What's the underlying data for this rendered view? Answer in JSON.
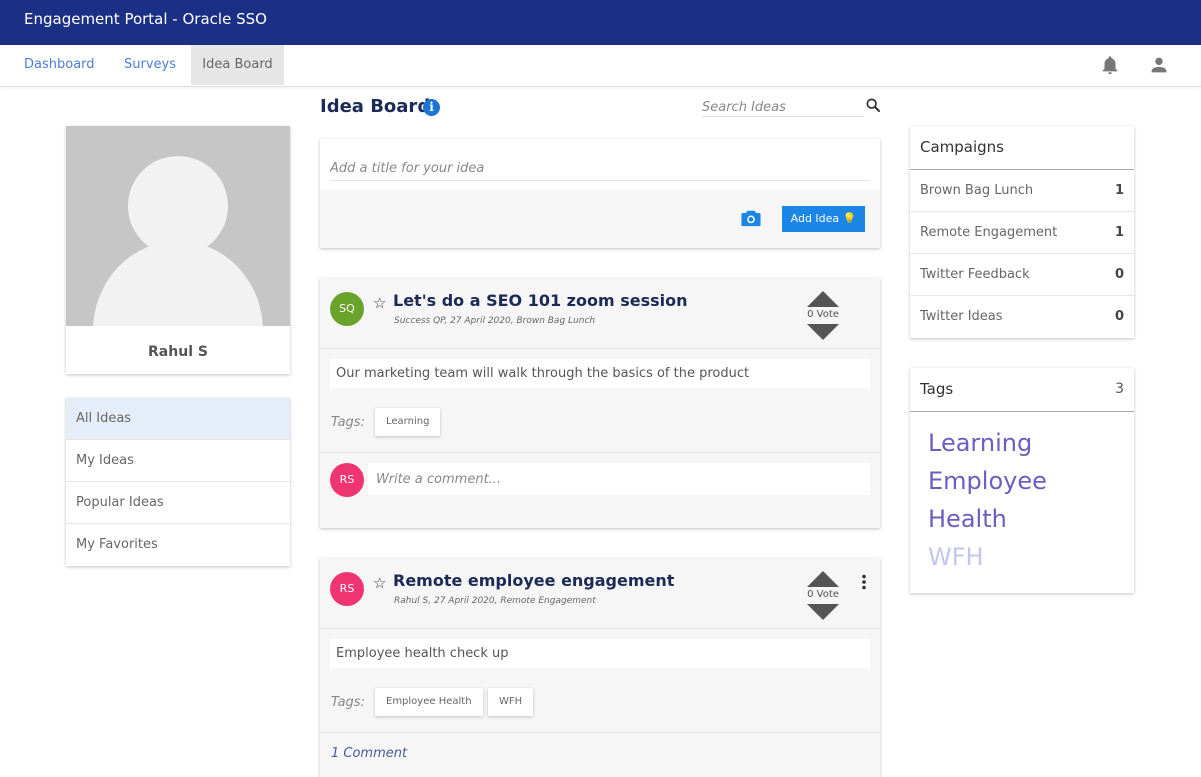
{
  "app": {
    "title": "Engagement Portal - Oracle SSO"
  },
  "nav": {
    "tabs": [
      {
        "label": "Dashboard"
      },
      {
        "label": "Surveys"
      },
      {
        "label": "Idea Board"
      }
    ],
    "icons": [
      "bell-icon",
      "user-icon"
    ]
  },
  "profile": {
    "name": "Rahul S"
  },
  "sidebar": {
    "items": [
      {
        "label": "All Ideas"
      },
      {
        "label": "My Ideas"
      },
      {
        "label": "Popular Ideas"
      },
      {
        "label": "My Favorites"
      }
    ]
  },
  "board": {
    "title": "Idea Board",
    "search_placeholder": "Search Ideas",
    "add_placeholder": "Add a title for your idea",
    "add_label": "Add Idea"
  },
  "ideas": [
    {
      "initials": "SQ",
      "avatar_color": "#6aa32a",
      "title": "Let's do a SEO 101 zoom session",
      "meta": "Success QP, 27 April 2020, Brown Bag Lunch",
      "vote_text": "0 Vote",
      "description": "Our marketing team will walk through the basics of the product",
      "tags_label": "Tags:",
      "tags": [
        "Learning"
      ],
      "commenter_initials": "RS",
      "commenter_color": "#ee3572",
      "comment_placeholder": "Write a comment..."
    },
    {
      "initials": "RS",
      "avatar_color": "#ee3572",
      "title": "Remote employee engagement",
      "meta": "Rahul S, 27 April 2020, Remote Engagement",
      "vote_text": "0 Vote",
      "description": "Employee health check up",
      "tags_label": "Tags:",
      "tags": [
        "Employee Health",
        "WFH"
      ],
      "comments_link": "1 Comment"
    }
  ],
  "campaigns": {
    "title": "Campaigns",
    "items": [
      {
        "name": "Brown Bag Lunch",
        "count": "1"
      },
      {
        "name": "Remote Engagement",
        "count": "1"
      },
      {
        "name": "Twitter Feedback",
        "count": "0"
      },
      {
        "name": "Twitter Ideas",
        "count": "0"
      }
    ]
  },
  "tags_panel": {
    "title": "Tags",
    "count": "3",
    "items": [
      "Learning",
      "Employee",
      "Health",
      "WFH"
    ]
  },
  "colors": {
    "header_bg": "#1b2f84",
    "accent": "#1c86e6",
    "nav_link": "#4a7fd4",
    "tag_cloud": "#6a5fc0",
    "tag_cloud_faded": "#c2c6ea"
  }
}
